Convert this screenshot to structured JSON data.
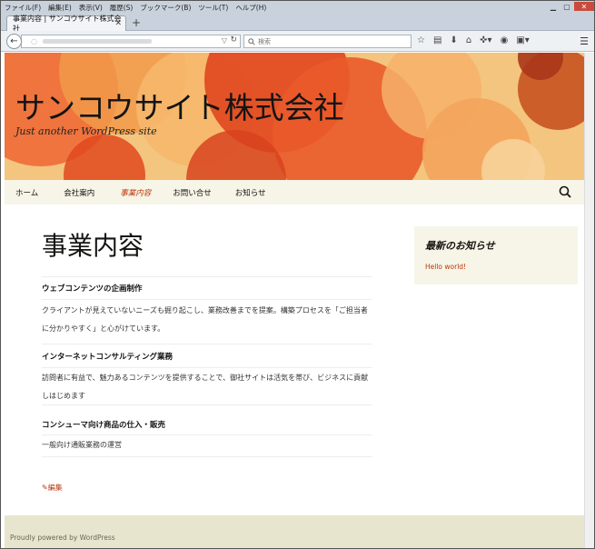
{
  "browser": {
    "menu": [
      "ファイル(F)",
      "編集(E)",
      "表示(V)",
      "履歴(S)",
      "ブックマーク(B)",
      "ツール(T)",
      "ヘルプ(H)"
    ],
    "tab_title": "事業内容 | サンコウサイト株式会社",
    "search_placeholder": "検索",
    "controls": {
      "minimize": "▁",
      "maximize": "▢",
      "close": "✕"
    }
  },
  "site": {
    "title": "サンコウサイト株式会社",
    "description": "Just another WordPress site",
    "nav": [
      "ホーム",
      "会社案内",
      "事業内容",
      "お問い合せ",
      "お知らせ"
    ],
    "active_nav_index": 2
  },
  "page": {
    "title": "事業内容",
    "sections": [
      {
        "heading": "ウェブコンテンツの企画制作",
        "body": "クライアントが見えていないニーズも掘り起こし、業務改善までを提案。構築プロセスを「ご担当者に分かりやすく」と心がけています。"
      },
      {
        "heading": "インターネットコンサルティング業務",
        "body": "訪問者に有益で、魅力あるコンテンツを提供することで、御社サイトは活気を帯び、ビジネスに貢献しはじめます"
      },
      {
        "heading": "コンシューマ向け商品の仕入・販売",
        "body": "一般向け通販業務の運営"
      }
    ],
    "edit_label": "編集"
  },
  "sidebar": {
    "widget_title": "最新のお知らせ",
    "post_link": "Hello world!"
  },
  "footer": {
    "text": "Proudly powered by WordPress"
  },
  "colors": {
    "accent": "#bc360a",
    "nav_bg": "#f7f5e7",
    "footer_bg": "#e8e5ce"
  }
}
